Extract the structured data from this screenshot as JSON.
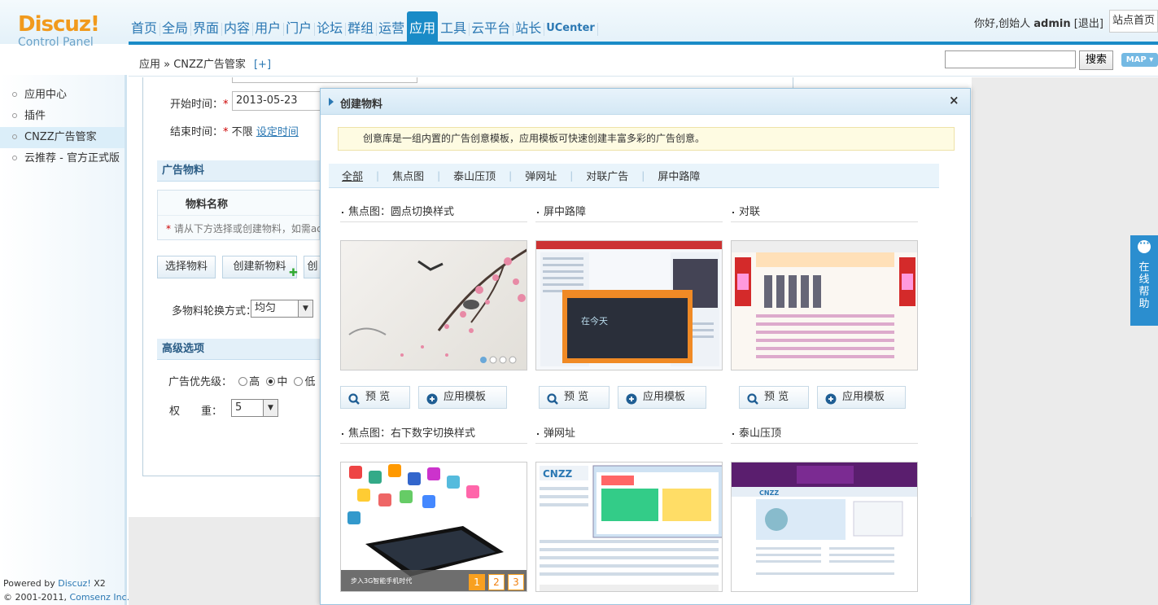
{
  "logo": {
    "line1": "Discuz!",
    "line2": "Control Panel"
  },
  "nav": {
    "items": [
      "首页",
      "全局",
      "界面",
      "内容",
      "用户",
      "门户",
      "论坛",
      "群组",
      "运营",
      "应用",
      "工具",
      "云平台",
      "站长",
      "UCenter"
    ],
    "active_index": 9
  },
  "user": {
    "greeting": "你好,创始人",
    "name": "admin",
    "logout": "[退出]",
    "home": "站点首页"
  },
  "breadcrumb": {
    "path": "应用 » CNZZ广告管家",
    "plus": "[+]"
  },
  "search": {
    "button": "搜索",
    "map": "MAP ▾",
    "value": ""
  },
  "sidebar": {
    "items": [
      "应用中心",
      "插件",
      "CNZZ广告管家",
      "云推荐 - 官方正式版"
    ],
    "active_index": 2
  },
  "footer": {
    "powered_prefix": "Powered by ",
    "powered_brand": "Discuz!",
    "powered_ver": " X2",
    "copy_prefix": "© 2001-2011, ",
    "copy_brand": "Comsenz Inc."
  },
  "form": {
    "start_label": "开始时间：",
    "start_value": "2013-05-23",
    "end_label": "结束时间：",
    "end_value": "不限",
    "end_link": "设定时间",
    "section_material": "广告物料",
    "col_material_name": "物料名称",
    "material_hint": "请从下方选择或创建物料，如需adj",
    "btn_select": "选择物料",
    "btn_create": "创建新物料",
    "btn_other": "创",
    "rotate_label": "多物料轮换方式：",
    "rotate_value": "均匀",
    "section_advanced": "高级选项",
    "priority_label": "广告优先级：",
    "priority_high": "高",
    "priority_mid": "中",
    "priority_low": "低",
    "weight_label": "权　　重：",
    "weight_value": "5"
  },
  "dialog": {
    "title": "创建物料",
    "close": "×",
    "notice": "创意库是一组内置的广告创意模板，应用模板可快速创建丰富多彩的广告创意。",
    "tabs": [
      "全部",
      "焦点图",
      "泰山压顶",
      "弹网址",
      "对联广告",
      "屏中路障"
    ],
    "active_tab": 0,
    "cards": [
      {
        "title": "焦点图：圆点切换样式"
      },
      {
        "title": "屏中路障"
      },
      {
        "title": "对联"
      },
      {
        "title": "焦点图：右下数字切换样式",
        "caption": "步入3G智能手机时代",
        "pages": [
          "1",
          "2",
          "3"
        ]
      },
      {
        "title": "弹网址"
      },
      {
        "title": "泰山压顶"
      }
    ],
    "preview_label": "预 览",
    "apply_label": "应用模板"
  },
  "helptab": {
    "text": "在线帮助"
  },
  "colors": {
    "accent": "#1a8bc7",
    "logo": "#f19a1d",
    "link": "#2b78b3"
  }
}
